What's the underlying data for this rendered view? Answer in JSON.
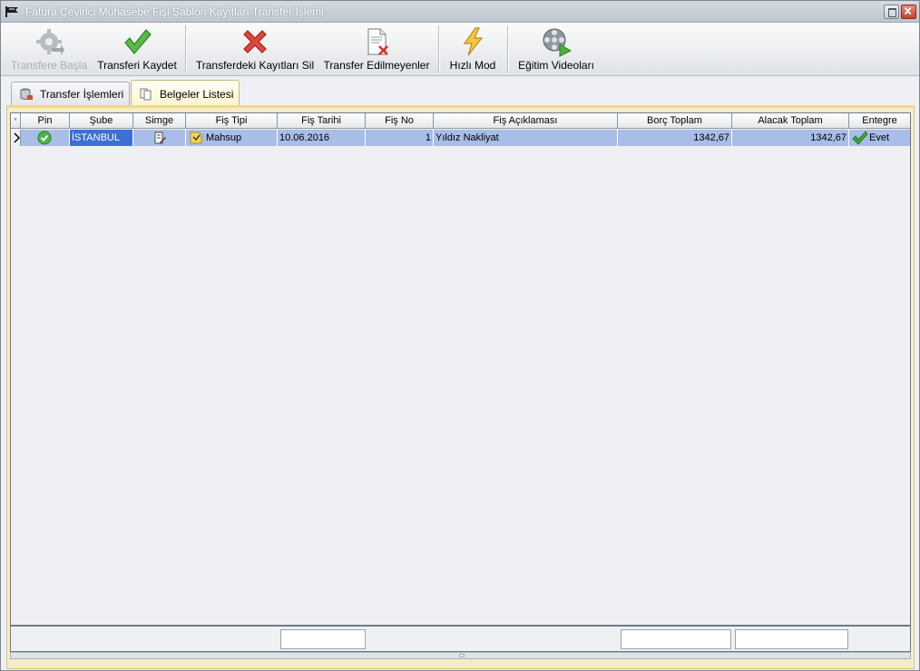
{
  "window": {
    "title": "Fatura Çevirici Muhasebe Fişi Şablon Kayıtları Transfer İşlemi"
  },
  "toolbar": {
    "buttons": [
      {
        "label": "Transfere Başla",
        "icon": "gear-transfer-icon",
        "enabled": false
      },
      {
        "label": "Transferi Kaydet",
        "icon": "checkmark-icon",
        "enabled": true
      },
      {
        "label": "Transferdeki Kayıtları Sil",
        "icon": "red-x-icon",
        "enabled": true
      },
      {
        "label": "Transfer Edilmeyenler",
        "icon": "document-delete-icon",
        "enabled": true
      },
      {
        "label": "Hızlı Mod",
        "icon": "lightning-icon",
        "enabled": true
      },
      {
        "label": "Eğitim Videoları",
        "icon": "film-reel-icon",
        "enabled": true
      }
    ]
  },
  "tabs": [
    {
      "label": "Transfer İşlemleri",
      "icon": "database-icon",
      "active": false
    },
    {
      "label": "Belgeler Listesi",
      "icon": "documents-icon",
      "active": true
    }
  ],
  "grid": {
    "corner_glyph": "*",
    "columns": [
      "Pin",
      "Şube",
      "Simge",
      "Fiş Tipi",
      "Fiş Tarihi",
      "Fiş No",
      "Fiş Açıklaması",
      "Borç Toplam",
      "Alacak Toplam",
      "Entegre"
    ],
    "rows": [
      {
        "pin": "green-check-circle-icon",
        "sube": "İSTANBUL",
        "simge": "document-pen-icon",
        "fis_tipi": "Mahsup",
        "fis_tarihi": "10.06.2016",
        "fis_no": "1",
        "fis_aciklamasi": "Yıldız Nakliyat",
        "borc_toplam": "1342,67",
        "alacak_toplam": "1342,67",
        "entegre": "Evet"
      }
    ]
  },
  "colors": {
    "selected_row": "#a8bde8",
    "selected_cell": "#3d6fd6",
    "panel_accent": "#f1d98a"
  }
}
